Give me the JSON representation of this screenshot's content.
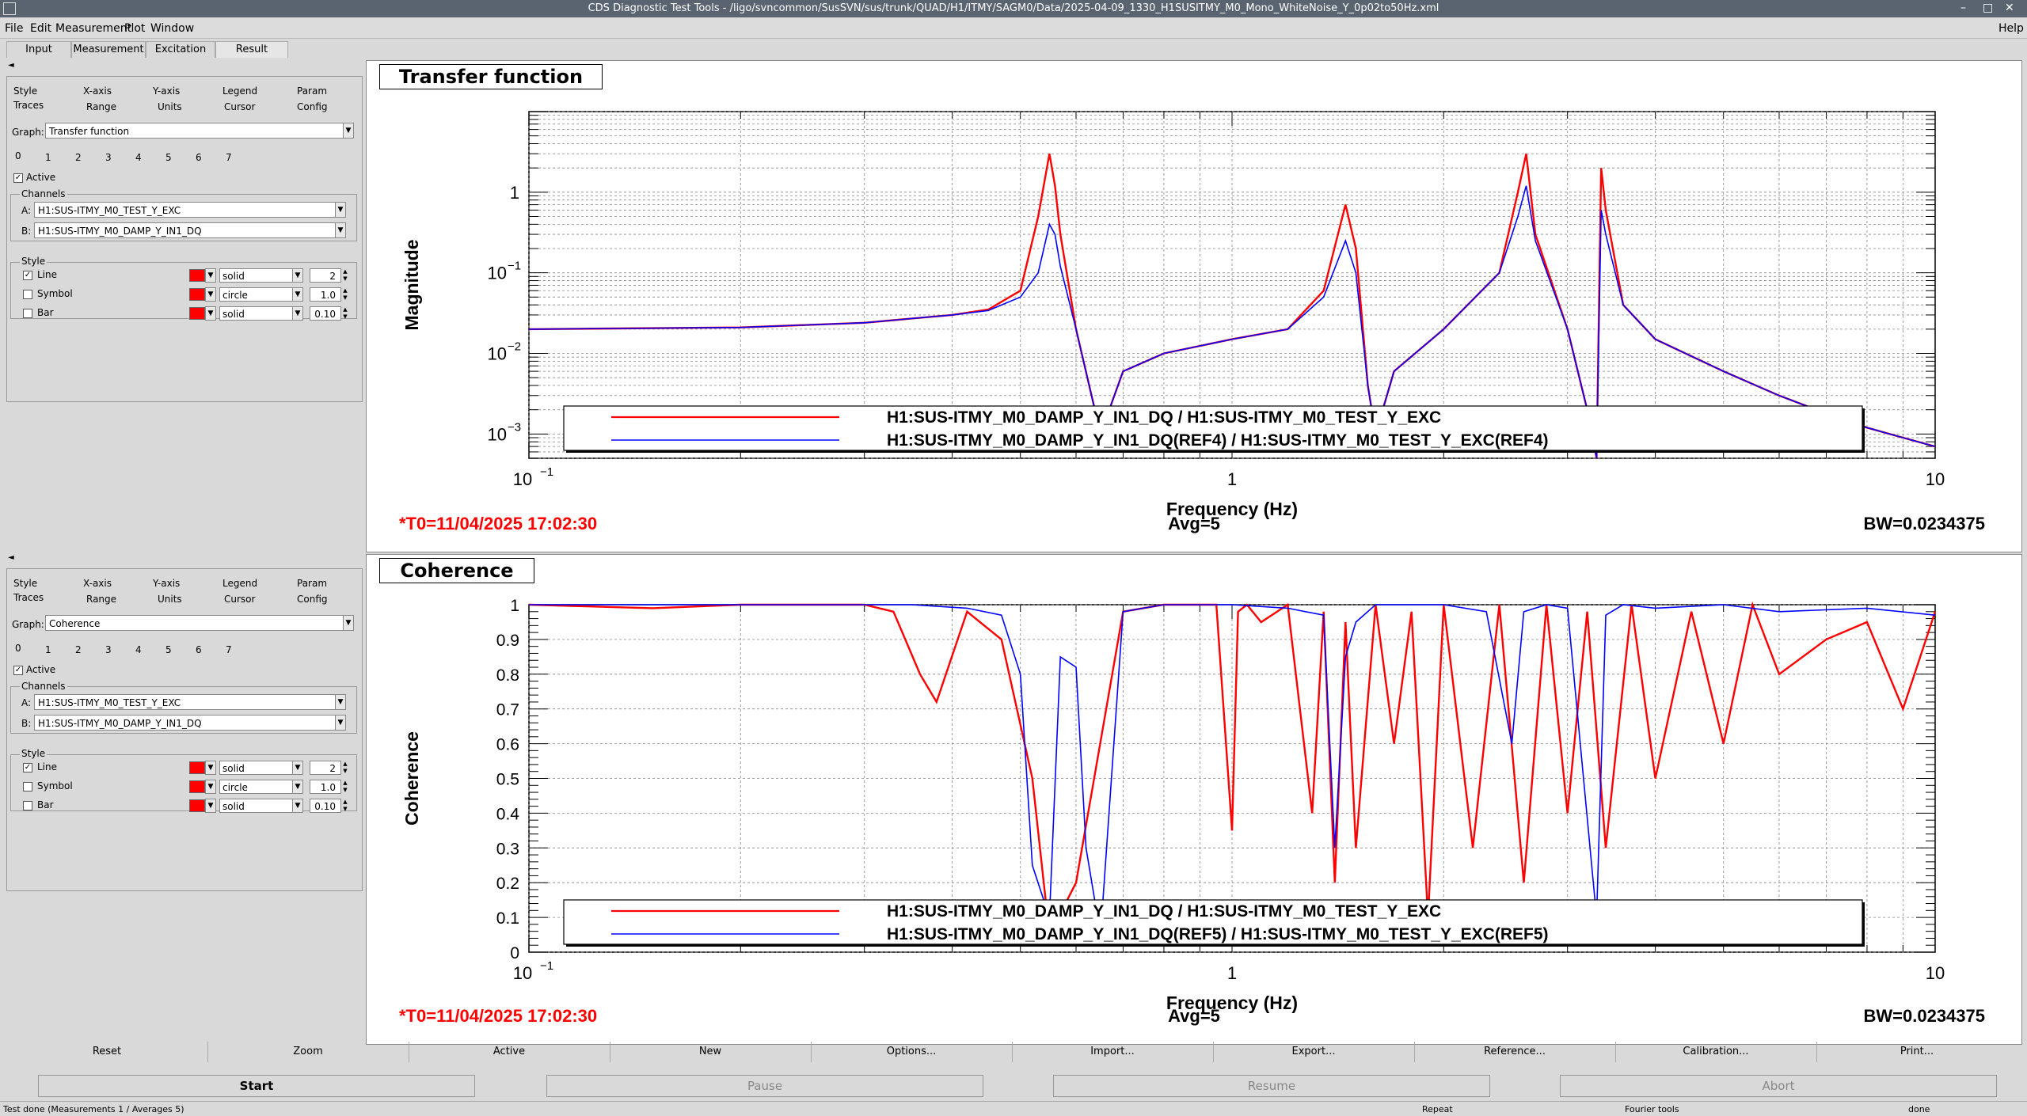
{
  "window": {
    "title": "CDS Diagnostic Test Tools - /ligo/svncommon/SusSVN/sus/trunk/QUAD/H1/ITMY/SAGM0/Data/2025-04-09_1330_H1SUSITMY_M0_Mono_WhiteNoise_Y_0p02to50Hz.xml",
    "controls": [
      "–",
      "□",
      "✕"
    ]
  },
  "menu": {
    "items": [
      "File",
      "Edit",
      "Measurement",
      "Plot",
      "Window"
    ],
    "help": "Help"
  },
  "main_tabs": [
    "Input",
    "Measurement",
    "Excitation",
    "Result"
  ],
  "collapse_arrow": "◄",
  "panels": [
    {
      "tabs_row1": [
        "Style",
        "X-axis",
        "Y-axis",
        "Legend",
        "Param"
      ],
      "tabs_row2": [
        "Traces",
        "Range",
        "Units",
        "Cursor",
        "Config"
      ],
      "graph_label": "Graph:",
      "graph_value": "Transfer function",
      "trace_tabs": [
        "0",
        "1",
        "2",
        "3",
        "4",
        "5",
        "6",
        "7"
      ],
      "active_label": "Active",
      "channels_title": "Channels",
      "chan_a_label": "A:",
      "chan_a": "H1:SUS-ITMY_M0_TEST_Y_EXC",
      "chan_b_label": "B:",
      "chan_b": "H1:SUS-ITMY_M0_DAMP_Y_IN1_DQ",
      "style_title": "Style",
      "line_label": "Line",
      "line_style": "solid",
      "line_width": "2",
      "symbol_label": "Symbol",
      "symbol_style": "circle",
      "symbol_size": "1.0",
      "bar_label": "Bar",
      "bar_style": "solid",
      "bar_width": "0.10"
    },
    {
      "tabs_row1": [
        "Style",
        "X-axis",
        "Y-axis",
        "Legend",
        "Param"
      ],
      "tabs_row2": [
        "Traces",
        "Range",
        "Units",
        "Cursor",
        "Config"
      ],
      "graph_label": "Graph:",
      "graph_value": "Coherence",
      "trace_tabs": [
        "0",
        "1",
        "2",
        "3",
        "4",
        "5",
        "6",
        "7"
      ],
      "active_label": "Active",
      "channels_title": "Channels",
      "chan_a_label": "A:",
      "chan_a": "H1:SUS-ITMY_M0_TEST_Y_EXC",
      "chan_b_label": "B:",
      "chan_b": "H1:SUS-ITMY_M0_DAMP_Y_IN1_DQ",
      "style_title": "Style",
      "line_label": "Line",
      "line_style": "solid",
      "line_width": "2",
      "symbol_label": "Symbol",
      "symbol_style": "circle",
      "symbol_size": "1.0",
      "bar_label": "Bar",
      "bar_style": "solid",
      "bar_width": "0.10"
    }
  ],
  "plots": [
    {
      "title": "Transfer function",
      "ylabel": "Magnitude",
      "xlabel": "Frequency (Hz)",
      "xticks": [
        "10",
        "1",
        "10"
      ],
      "xtick_exp": [
        "−1",
        "",
        ""
      ],
      "yticks": [
        "1",
        "10",
        "10",
        "10"
      ],
      "ytick_exp": [
        "",
        "−1",
        "−2",
        "−3"
      ],
      "legend": [
        "H1:SUS-ITMY_M0_DAMP_Y_IN1_DQ / H1:SUS-ITMY_M0_TEST_Y_EXC",
        "H1:SUS-ITMY_M0_DAMP_Y_IN1_DQ(REF4) / H1:SUS-ITMY_M0_TEST_Y_EXC(REF4)"
      ],
      "t0": "*T0=11/04/2025 17:02:30",
      "avg": "Avg=5",
      "bw": "BW=0.0234375"
    },
    {
      "title": "Coherence",
      "ylabel": "Coherence",
      "xlabel": "Frequency (Hz)",
      "xticks": [
        "10",
        "1",
        "10"
      ],
      "xtick_exp": [
        "−1",
        "",
        ""
      ],
      "yticks": [
        "0",
        "0.1",
        "0.2",
        "0.3",
        "0.4",
        "0.5",
        "0.6",
        "0.7",
        "0.8",
        "0.9",
        "1"
      ],
      "legend": [
        "H1:SUS-ITMY_M0_DAMP_Y_IN1_DQ / H1:SUS-ITMY_M0_TEST_Y_EXC",
        "H1:SUS-ITMY_M0_DAMP_Y_IN1_DQ(REF5) / H1:SUS-ITMY_M0_TEST_Y_EXC(REF5)"
      ],
      "t0": "*T0=11/04/2025 17:02:30",
      "avg": "Avg=5",
      "bw": "BW=0.0234375"
    }
  ],
  "chart_data": [
    {
      "type": "line",
      "title": "Transfer function",
      "xlabel": "Frequency (Hz)",
      "ylabel": "Magnitude",
      "xscale": "log",
      "yscale": "log",
      "xlim": [
        0.1,
        10
      ],
      "ylim": [
        0.0005,
        10
      ],
      "grid": true,
      "legend_position": "bottom",
      "series": [
        {
          "name": "H1:SUS-ITMY_M0_DAMP_Y_IN1_DQ / H1:SUS-ITMY_M0_TEST_Y_EXC",
          "color": "#ff0000",
          "x": [
            0.1,
            0.2,
            0.3,
            0.4,
            0.45,
            0.5,
            0.53,
            0.55,
            0.56,
            0.57,
            0.6,
            0.65,
            0.7,
            0.8,
            1.0,
            1.2,
            1.35,
            1.45,
            1.5,
            1.56,
            1.6,
            1.7,
            2.0,
            2.4,
            2.55,
            2.62,
            2.7,
            3.0,
            3.2,
            3.3,
            3.35,
            3.4,
            3.6,
            4.0,
            5.0,
            6.0,
            7.0,
            8.0,
            9.0,
            10.0
          ],
          "y": [
            0.02,
            0.021,
            0.024,
            0.03,
            0.035,
            0.06,
            0.5,
            3.0,
            1.2,
            0.3,
            0.02,
            0.001,
            0.006,
            0.01,
            0.015,
            0.02,
            0.06,
            0.7,
            0.2,
            0.004,
            0.001,
            0.006,
            0.02,
            0.1,
            1.0,
            3.0,
            0.3,
            0.02,
            0.002,
            0.0005,
            2.0,
            0.6,
            0.04,
            0.015,
            0.006,
            0.003,
            0.0018,
            0.0012,
            0.0009,
            0.0007
          ]
        },
        {
          "name": "H1:SUS-ITMY_M0_DAMP_Y_IN1_DQ(REF4) / H1:SUS-ITMY_M0_TEST_Y_EXC(REF4)",
          "color": "#0000ff",
          "x": [
            0.1,
            0.2,
            0.3,
            0.4,
            0.45,
            0.5,
            0.53,
            0.55,
            0.56,
            0.57,
            0.6,
            0.65,
            0.7,
            0.8,
            1.0,
            1.2,
            1.35,
            1.45,
            1.5,
            1.56,
            1.6,
            1.7,
            2.0,
            2.4,
            2.55,
            2.62,
            2.7,
            3.0,
            3.2,
            3.3,
            3.35,
            3.4,
            3.6,
            4.0,
            5.0,
            6.0,
            7.0,
            8.0,
            9.0,
            10.0
          ],
          "y": [
            0.02,
            0.021,
            0.024,
            0.03,
            0.034,
            0.05,
            0.1,
            0.4,
            0.3,
            0.12,
            0.02,
            0.001,
            0.006,
            0.01,
            0.015,
            0.02,
            0.05,
            0.25,
            0.1,
            0.004,
            0.001,
            0.006,
            0.02,
            0.1,
            0.5,
            1.2,
            0.25,
            0.02,
            0.002,
            0.0005,
            0.6,
            0.3,
            0.04,
            0.015,
            0.006,
            0.003,
            0.0018,
            0.0012,
            0.0009,
            0.0007
          ]
        }
      ]
    },
    {
      "type": "line",
      "title": "Coherence",
      "xlabel": "Frequency (Hz)",
      "ylabel": "Coherence",
      "xscale": "log",
      "xlim": [
        0.1,
        10
      ],
      "ylim": [
        0,
        1
      ],
      "grid": true,
      "legend_position": "bottom",
      "series": [
        {
          "name": "H1:SUS-ITMY_M0_DAMP_Y_IN1_DQ / H1:SUS-ITMY_M0_TEST_Y_EXC",
          "color": "#ff0000",
          "x": [
            0.1,
            0.15,
            0.2,
            0.3,
            0.33,
            0.36,
            0.38,
            0.42,
            0.47,
            0.52,
            0.55,
            0.6,
            0.7,
            0.8,
            0.95,
            1.0,
            1.02,
            1.05,
            1.1,
            1.2,
            1.3,
            1.35,
            1.4,
            1.45,
            1.5,
            1.6,
            1.7,
            1.8,
            1.9,
            2.0,
            2.2,
            2.4,
            2.6,
            2.8,
            3.0,
            3.2,
            3.4,
            3.7,
            4.0,
            4.5,
            5.0,
            5.5,
            6.0,
            7.0,
            8.0,
            9.0,
            10.0
          ],
          "y": [
            1.0,
            0.99,
            1.0,
            1.0,
            0.98,
            0.8,
            0.72,
            0.98,
            0.9,
            0.5,
            0.05,
            0.2,
            0.98,
            1.0,
            1.0,
            0.35,
            0.98,
            1.0,
            0.95,
            1.0,
            0.4,
            0.98,
            0.2,
            0.95,
            0.3,
            1.0,
            0.6,
            0.98,
            0.1,
            1.0,
            0.3,
            1.0,
            0.2,
            1.0,
            0.4,
            0.98,
            0.3,
            1.0,
            0.5,
            0.98,
            0.6,
            1.0,
            0.8,
            0.9,
            0.95,
            0.7,
            0.98
          ]
        },
        {
          "name": "H1:SUS-ITMY_M0_DAMP_Y_IN1_DQ(REF5) / H1:SUS-ITMY_M0_TEST_Y_EXC(REF5)",
          "color": "#0000ff",
          "x": [
            0.1,
            0.2,
            0.35,
            0.42,
            0.47,
            0.5,
            0.52,
            0.55,
            0.57,
            0.6,
            0.62,
            0.65,
            0.7,
            0.8,
            1.0,
            1.2,
            1.35,
            1.4,
            1.45,
            1.5,
            1.6,
            2.0,
            2.3,
            2.5,
            2.6,
            2.8,
            3.0,
            3.3,
            3.4,
            3.6,
            4.0,
            5.0,
            6.0,
            8.0,
            10.0
          ],
          "y": [
            1.0,
            1.0,
            1.0,
            0.99,
            0.97,
            0.8,
            0.25,
            0.1,
            0.85,
            0.82,
            0.3,
            0.05,
            0.98,
            1.0,
            1.0,
            0.99,
            0.97,
            0.3,
            0.85,
            0.95,
            1.0,
            1.0,
            0.98,
            0.6,
            0.98,
            1.0,
            0.99,
            0.1,
            0.97,
            1.0,
            0.99,
            1.0,
            0.98,
            0.99,
            0.97
          ]
        }
      ]
    }
  ],
  "buttons": [
    "Reset",
    "Zoom",
    "Active",
    "New",
    "Options...",
    "Import...",
    "Export...",
    "Reference...",
    "Calibration...",
    "Print..."
  ],
  "run_buttons": [
    "Start",
    "Pause",
    "Resume",
    "Abort"
  ],
  "status": {
    "left": "Test done (Measurements 1 / Averages 5)",
    "repeat": "Repeat",
    "fourier": "Fourier tools",
    "done": "done"
  }
}
